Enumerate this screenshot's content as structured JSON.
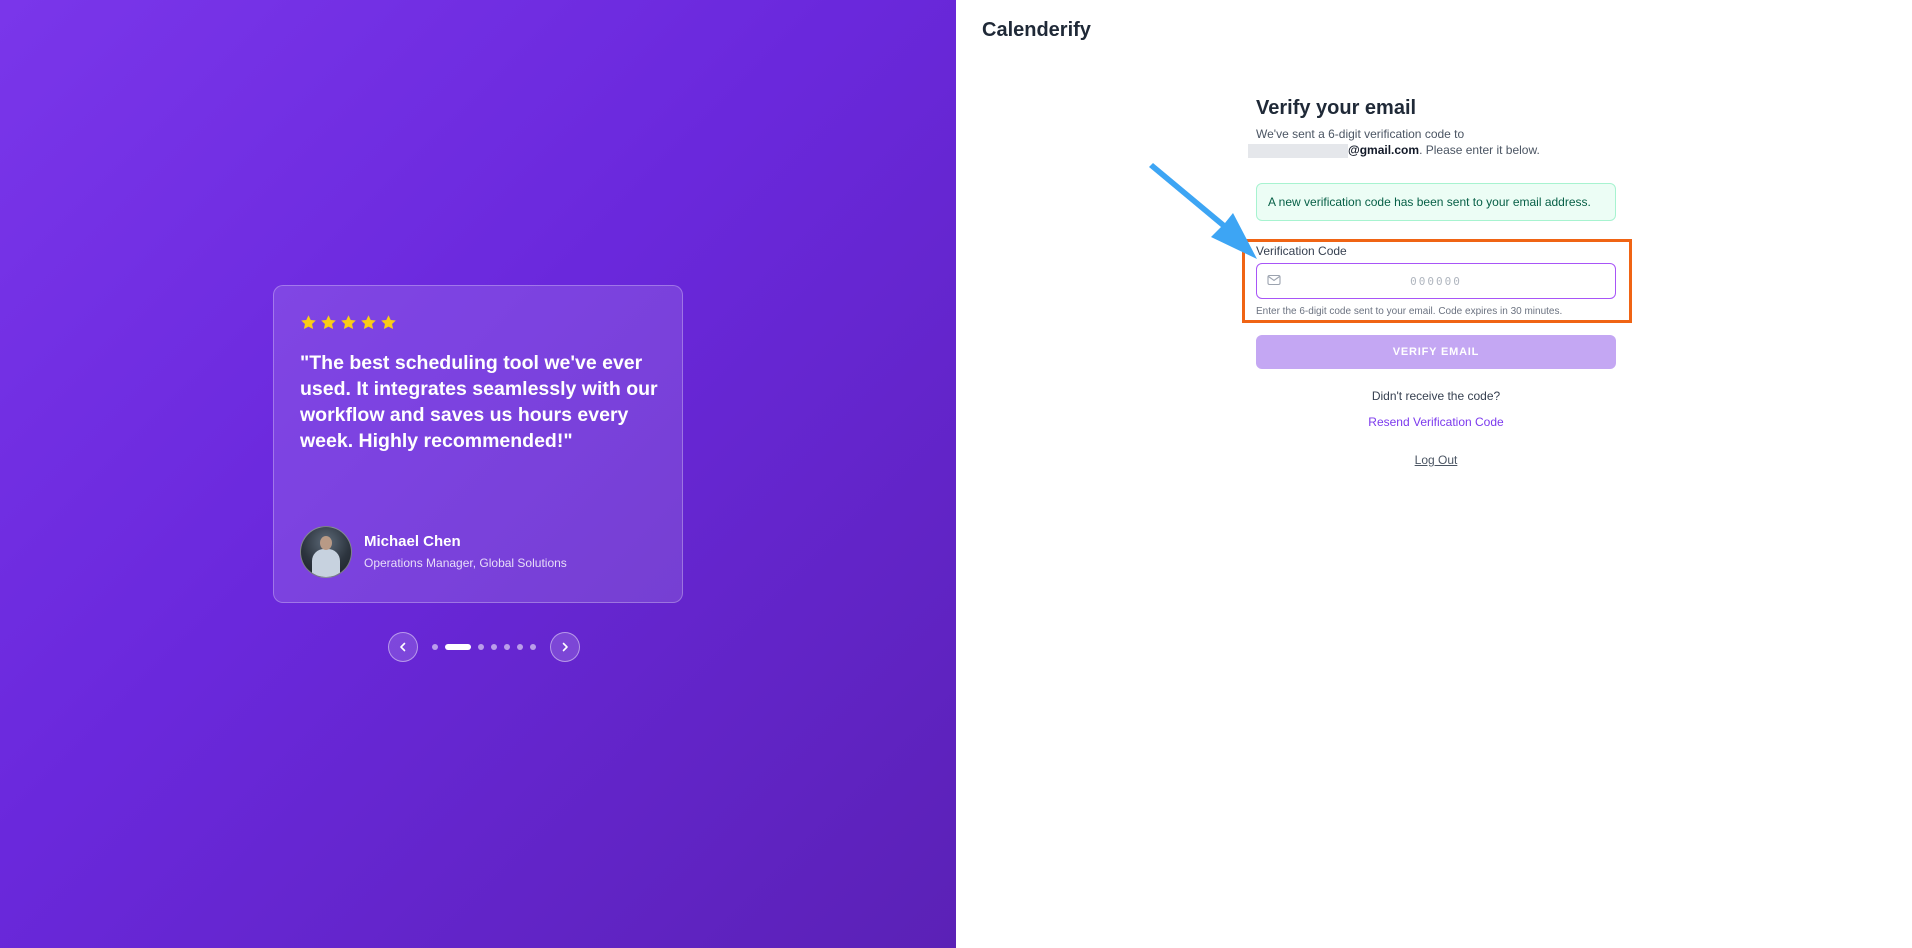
{
  "brand": {
    "name": "Calenderify"
  },
  "testimonial": {
    "rating": 5,
    "quote": "\"The best scheduling tool we've ever used. It integrates seamlessly with our workflow and saves us hours every week. Highly recommended!\"",
    "author_name": "Michael Chen",
    "author_role": "Operations Manager, Global Solutions"
  },
  "carousel": {
    "slide_count": 7,
    "active_index": 1
  },
  "verify": {
    "title": "Verify your email",
    "subtitle_prefix": "We've sent a 6-digit verification code to",
    "email_domain": "@gmail.com",
    "subtitle_suffix": ". Please enter it below.",
    "alert": "A new verification code has been sent to your email address.",
    "field_label": "Verification Code",
    "input_placeholder": "000000",
    "input_value": "",
    "helper": "Enter the 6-digit code sent to your email. Code expires in 30 minutes.",
    "submit_label": "VERIFY EMAIL",
    "didnt_receive": "Didn't receive the code?",
    "resend_label": "Resend Verification Code",
    "logout_label": "Log Out"
  },
  "colors": {
    "accent": "#7c3aed",
    "panel_gradient_start": "#7a36ea",
    "panel_gradient_end": "#5b21b6",
    "button_disabled": "#c4a7f3",
    "alert_bg": "#ecfdf5",
    "alert_text": "#065f46",
    "highlight": "#f06414",
    "annotation_arrow": "#3da5f4",
    "star": "#facc15"
  },
  "icons": {
    "input": "mail-icon",
    "prev": "chevron-left-icon",
    "next": "chevron-right-icon",
    "star": "star-icon"
  }
}
